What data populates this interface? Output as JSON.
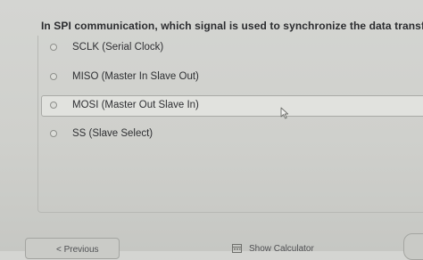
{
  "question": {
    "text": "In SPI communication, which signal is used to synchronize the data transfer?"
  },
  "options": [
    {
      "label": "SCLK (Serial Clock)",
      "selected": false
    },
    {
      "label": "MISO (Master In Slave Out)",
      "selected": false
    },
    {
      "label": "MOSI (Master Out Slave In)",
      "selected": true
    },
    {
      "label": "SS (Slave Select)",
      "selected": false
    }
  ],
  "footer": {
    "previous_label": "< Previous",
    "calculator_label": "Show Calculator",
    "calculator_icon": "calculator-icon"
  },
  "colors": {
    "background": "#d0d1cd",
    "selected_row": "#e1e2de",
    "text": "#2f3033"
  }
}
